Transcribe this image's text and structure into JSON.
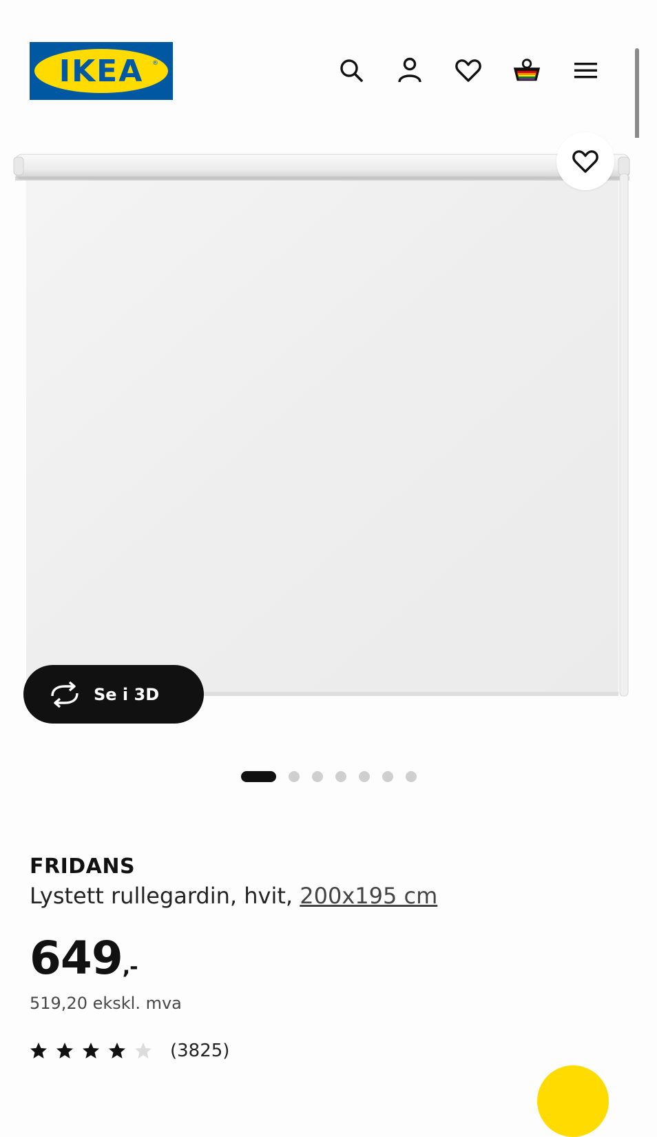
{
  "header": {
    "logo_text": "IKEA",
    "icons": [
      "search-icon",
      "user-icon",
      "heart-icon",
      "basket-icon",
      "menu-icon"
    ]
  },
  "gallery": {
    "view_3d_label": "Se i 3D",
    "slide_count": 7,
    "active_slide": 1
  },
  "product": {
    "brand": "FRIDANS",
    "description_prefix": "Lystett rullegardin, hvit, ",
    "size": "200x195 cm",
    "price_main": "649",
    "price_suffix": ",-",
    "price_ex_vat": "519,20 ekskl. mva",
    "rating_stars": 4,
    "rating_max": 5,
    "review_count": "(3825)"
  },
  "colors": {
    "ikea_blue": "#0058a3",
    "ikea_yellow": "#ffdb00",
    "dark": "#111111"
  }
}
